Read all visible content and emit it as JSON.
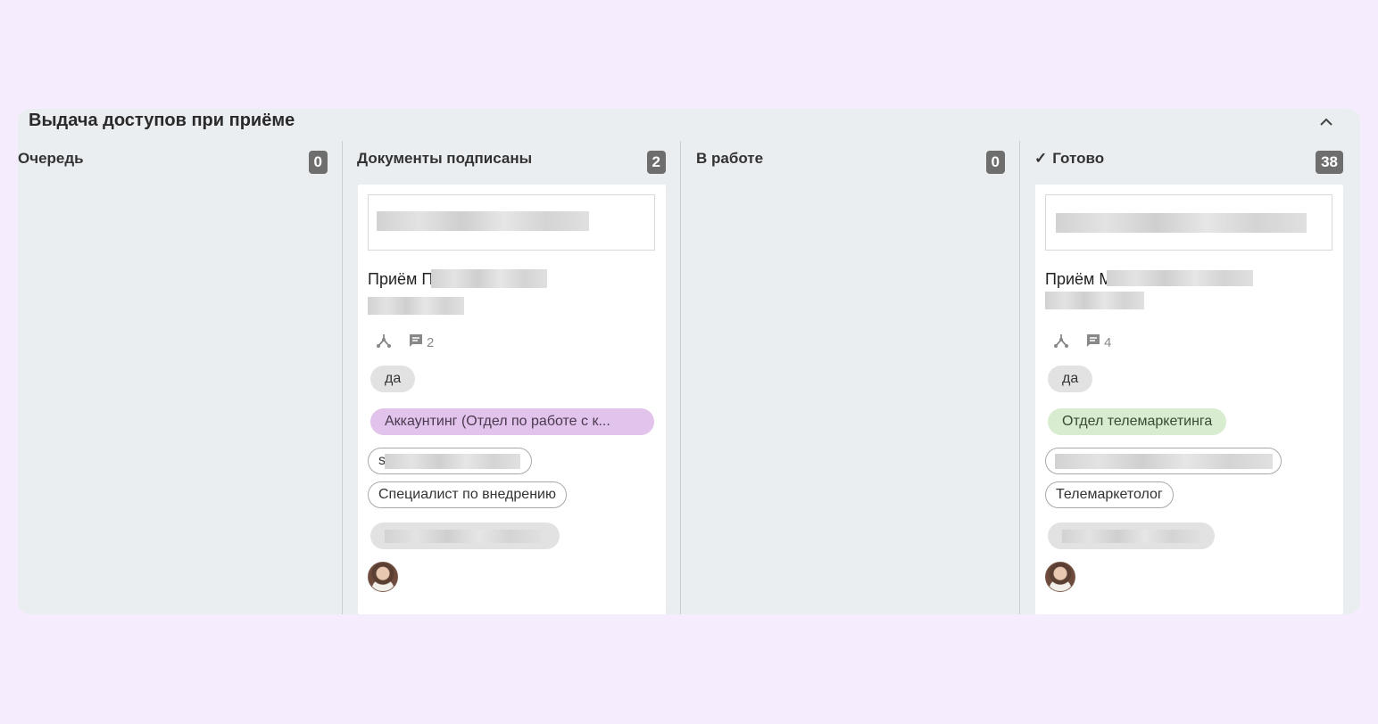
{
  "board": {
    "title": "Выдача доступов при приёме",
    "columns": [
      {
        "title": "Очередь",
        "count": "0",
        "check": ""
      },
      {
        "title": "Документы подписаны",
        "count": "2",
        "check": ""
      },
      {
        "title": "В работе",
        "count": "0",
        "check": ""
      },
      {
        "title": "Готово",
        "count": "38",
        "check": "✓"
      }
    ]
  },
  "cards": [
    {
      "name_prefix": "Приём П",
      "comments": "2",
      "tag_yes": "да",
      "department": "Аккаунтинг (Отдел по работе с к...",
      "email_prefix": "s",
      "position": "Специалист по внедрению"
    },
    {
      "name_prefix": "Приём М",
      "comments": "4",
      "tag_yes": "да",
      "department": "Отдел телемаркетинга",
      "email_prefix": "",
      "position": "Телемаркетолог"
    }
  ],
  "icons": {
    "collapse": "chevron-up-icon",
    "subtasks": "subtasks-icon",
    "comments": "comment-icon"
  }
}
